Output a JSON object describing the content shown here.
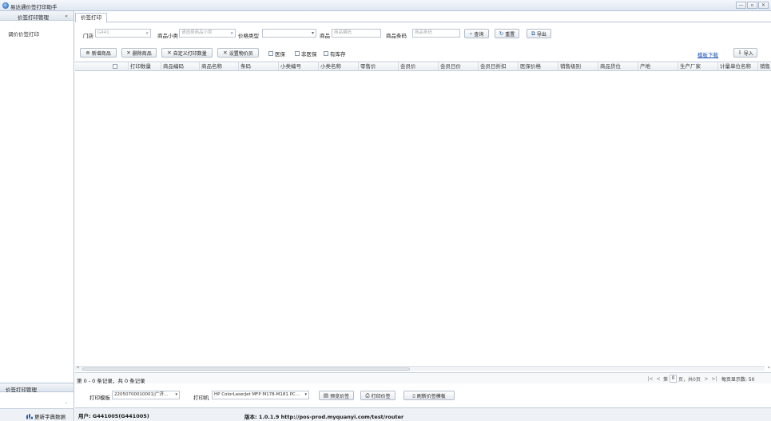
{
  "window": {
    "title": "易达通价签打印助手",
    "min": "—",
    "max": "▫",
    "close": "✕"
  },
  "sidebar": {
    "header": "价签打印管理",
    "collapse": "«",
    "items": [
      {
        "label": "调价价签打印"
      }
    ],
    "bottom_header": "价签打印管理",
    "expand_arrow": "⌄",
    "refresh_button": "更新字典数据"
  },
  "tabs": [
    {
      "label": "价签打印"
    }
  ],
  "filters": {
    "store_label": "门店",
    "store_value": "G441",
    "subclass_label": "商品小类",
    "subclass_placeholder": "请选择商品小类",
    "price_type_label": "价格类型",
    "price_type_value": "",
    "product_label": "商品",
    "product_placeholder": "商品编码",
    "barcode_label": "商品条码",
    "barcode_placeholder": "商品条码",
    "search_button": "查询",
    "reset_button": "重置",
    "export_button": "导出"
  },
  "toolbar": {
    "add_button": "新增商品",
    "delete_button": "删除商品",
    "custom_qty_button": "自定义打印数量",
    "set_price_button": "设置物价员",
    "check_hot": "医保",
    "check_non": "非医保",
    "check_stock": "有库存",
    "template_link": "模板下载",
    "import_button": "导入"
  },
  "table": {
    "columns": [
      "打印数量",
      "商品编码",
      "商品名称",
      "条码",
      "小类编号",
      "小类名称",
      "零售价",
      "会员价",
      "会员日价",
      "会员日折扣",
      "医保价格",
      "销售级别",
      "商品货位",
      "产地",
      "生产厂家",
      "计量单位名称",
      "销售"
    ],
    "rows": []
  },
  "pager": {
    "info": "第 0 - 0 条记录，共 0 条记录",
    "first": "|<",
    "prev": "<",
    "page_prefix": "第",
    "page_value": "0",
    "page_suffix": "页，共0页",
    "next": ">",
    "last": ">|",
    "per_page": "每页显示数: 50"
  },
  "print": {
    "template_label": "打印模板",
    "template_value": "22050700010001|广济...",
    "printer_label": "打印机",
    "printer_value": "HP ColorLaserJet MFP M178-M181 PC...",
    "preview_button": "预览价签",
    "print_button": "打印价签",
    "refresh_template_button": "刷新价签模板"
  },
  "status": {
    "user": "用户: G441005(G441005)",
    "version": "版本: 1.0.1.9   http://pos-prod.myquanyi.com/test/router"
  }
}
